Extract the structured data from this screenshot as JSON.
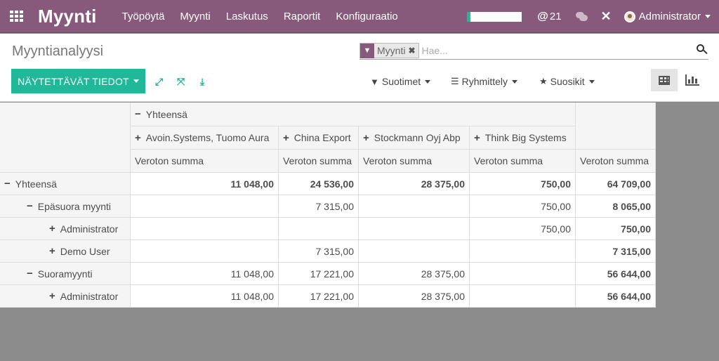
{
  "navbar": {
    "brand": "Myynti",
    "menu": [
      "Työpöytä",
      "Myynti",
      "Laskutus",
      "Raportit",
      "Konfiguraatio"
    ],
    "mentions_count": "21",
    "user_name": "Administrator",
    "accent_color": "#875a7b"
  },
  "control_panel": {
    "title": "Myyntianalyysi",
    "search": {
      "facet_value": "Myynti",
      "placeholder": "Hae..."
    },
    "measures_button": "NÄYTETTÄVÄT TIEDOT",
    "filters_label": "Suotimet",
    "group_label": "Ryhmittely",
    "favorites_label": "Suosikit",
    "primary_color": "#21b799"
  },
  "pivot": {
    "col_total_label": "Yhteensä",
    "columns": [
      "Avoin.Systems, Tuomo Aura",
      "China Export",
      "Stockmann Oyj Abp",
      "Think Big Systems"
    ],
    "measure": "Veroton summa",
    "rows": [
      {
        "label": "Yhteensä",
        "sign": "−",
        "level": 0,
        "values": [
          "11 048,00",
          "24 536,00",
          "28 375,00",
          "750,00"
        ],
        "total": "64 709,00"
      },
      {
        "label": "Epäsuora myynti",
        "sign": "−",
        "level": 1,
        "values": [
          "",
          "7 315,00",
          "",
          "750,00"
        ],
        "total": "8 065,00"
      },
      {
        "label": "Administrator",
        "sign": "+",
        "level": 2,
        "values": [
          "",
          "",
          "",
          "750,00"
        ],
        "total": "750,00"
      },
      {
        "label": "Demo User",
        "sign": "+",
        "level": 2,
        "values": [
          "",
          "7 315,00",
          "",
          ""
        ],
        "total": "7 315,00"
      },
      {
        "label": "Suoramyynti",
        "sign": "−",
        "level": 1,
        "values": [
          "11 048,00",
          "17 221,00",
          "28 375,00",
          ""
        ],
        "total": "56 644,00"
      },
      {
        "label": "Administrator",
        "sign": "+",
        "level": 2,
        "values": [
          "11 048,00",
          "17 221,00",
          "28 375,00",
          ""
        ],
        "total": "56 644,00"
      }
    ]
  }
}
